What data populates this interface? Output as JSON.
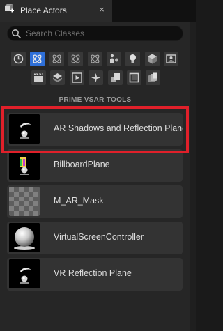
{
  "window": {
    "title": "Place Actors",
    "close_glyph": "×"
  },
  "search": {
    "placeholder": "Search Classes",
    "value": ""
  },
  "categories": [
    {
      "icon": "clock-icon",
      "active": false
    },
    {
      "icon": "basic-shapes-icon",
      "active": true
    },
    {
      "icon": "atom-icon",
      "active": false
    },
    {
      "icon": "atom-icon",
      "active": false
    },
    {
      "icon": "atom-icon",
      "active": false
    },
    {
      "icon": "character-icon",
      "active": false
    },
    {
      "icon": "light-bulb-icon",
      "active": false
    },
    {
      "icon": "cube-icon",
      "active": false
    },
    {
      "icon": "portrait-icon",
      "active": false
    },
    {
      "icon": "clapperboard-icon",
      "active": false
    },
    {
      "icon": "visual-effects-icon",
      "active": false
    },
    {
      "icon": "play-box-icon",
      "active": false
    },
    {
      "icon": "sparkle-icon",
      "active": false
    },
    {
      "icon": "volumes-icon",
      "active": false
    },
    {
      "icon": "frame-icon",
      "active": false
    },
    {
      "icon": "all-classes-icon",
      "active": false
    }
  ],
  "section": {
    "title": "PRIME VSAR TOOLS"
  },
  "items": [
    {
      "label": "AR Shadows and Reflection Plane",
      "thumb": "sphere-actor-thumb",
      "highlighted": true
    },
    {
      "label": "BillboardPlane",
      "thumb": "billboard-thumb",
      "highlighted": false
    },
    {
      "label": "M_AR_Mask",
      "thumb": "checker-thumb",
      "highlighted": false
    },
    {
      "label": "VirtualScreenController",
      "thumb": "sphere-thumb",
      "highlighted": false
    },
    {
      "label": "VR Reflection Plane",
      "thumb": "sphere-actor-thumb",
      "highlighted": false
    }
  ],
  "colors": {
    "accent": "#2e6fd8",
    "highlight_border": "#e0202a",
    "panel": "#262626",
    "item": "#333333"
  }
}
